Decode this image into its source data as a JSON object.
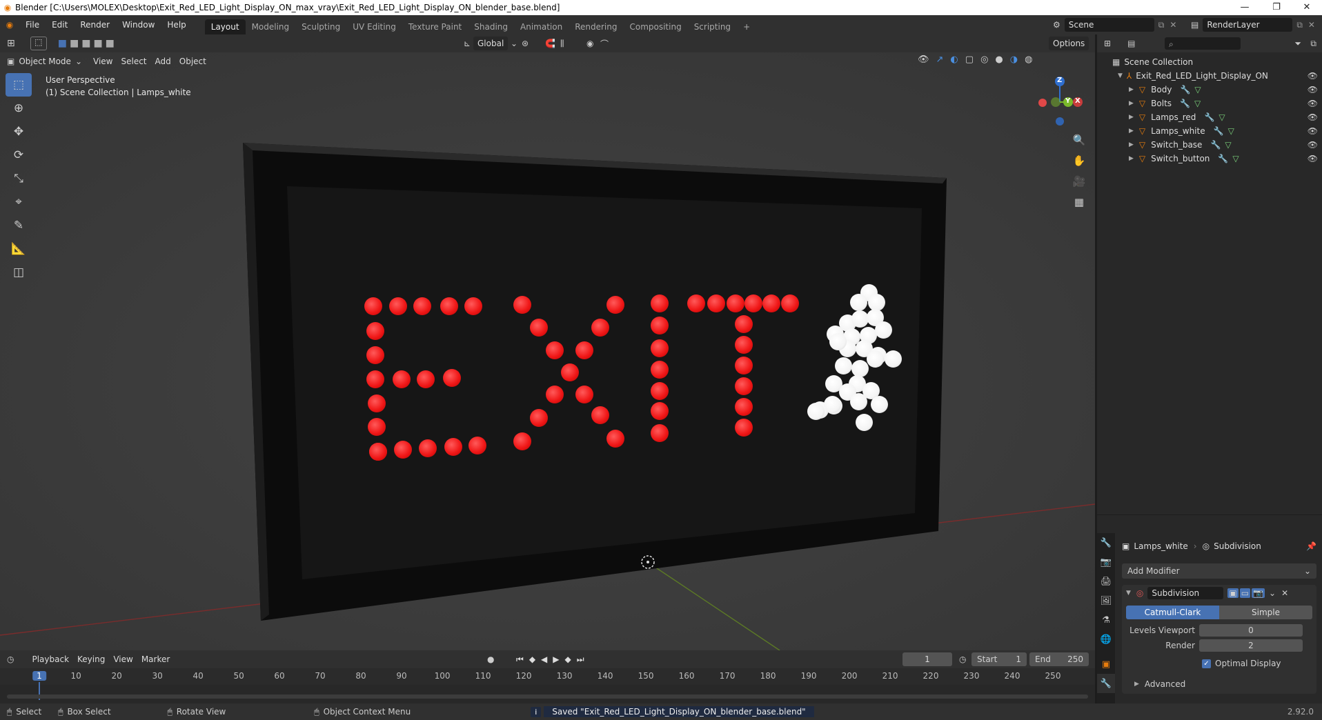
{
  "titlebar": {
    "title": "Blender [C:\\Users\\MOLEX\\Desktop\\Exit_Red_LED_Light_Display_ON_max_vray\\Exit_Red_LED_Light_Display_ON_blender_base.blend]",
    "minimize": "—",
    "maximize": "❐",
    "close": "✕"
  },
  "menu": {
    "items": [
      "File",
      "Edit",
      "Render",
      "Window",
      "Help"
    ]
  },
  "workspaces": {
    "tabs": [
      "Layout",
      "Modeling",
      "Sculpting",
      "UV Editing",
      "Texture Paint",
      "Shading",
      "Animation",
      "Rendering",
      "Compositing",
      "Scripting"
    ],
    "active": "Layout",
    "add": "+"
  },
  "scene": {
    "name": "Scene",
    "render_layer": "RenderLayer"
  },
  "viewport_header": {
    "mode": "Object Mode",
    "menus": [
      "View",
      "Select",
      "Add",
      "Object"
    ],
    "transform_orientation": "Global",
    "options": "Options"
  },
  "viewport": {
    "perspective_label": "User Perspective",
    "collection_label": "(1) Scene Collection | Lamps_white",
    "gizmo_axes": {
      "x": "X",
      "y": "Y",
      "z": "Z"
    }
  },
  "outliner": {
    "root": "Scene Collection",
    "collection": "Exit_Red_LED_Light_Display_ON",
    "objects": [
      "Body",
      "Bolts",
      "Lamps_red",
      "Lamps_white",
      "Switch_base",
      "Switch_button"
    ]
  },
  "properties": {
    "object_name": "Lamps_white",
    "modifier_context": "Subdivision",
    "add_modifier": "Add Modifier",
    "modifier_name": "Subdivision",
    "subdiv_types": [
      "Catmull-Clark",
      "Simple"
    ],
    "active_subdiv_type": "Catmull-Clark",
    "levels_viewport_label": "Levels Viewport",
    "levels_viewport_value": "0",
    "render_label": "Render",
    "render_value": "2",
    "optimal_display_label": "Optimal Display",
    "optimal_display_checked": true,
    "advanced_label": "Advanced"
  },
  "timeline": {
    "menus": [
      "Playback",
      "Keying",
      "View",
      "Marker"
    ],
    "current_frame": "1",
    "start_label": "Start",
    "start_value": "1",
    "end_label": "End",
    "end_value": "250",
    "ruler_ticks": [
      "1",
      "10",
      "20",
      "30",
      "40",
      "50",
      "60",
      "70",
      "80",
      "90",
      "100",
      "110",
      "120",
      "130",
      "140",
      "150",
      "160",
      "170",
      "180",
      "190",
      "200",
      "210",
      "220",
      "230",
      "240",
      "250"
    ]
  },
  "statusbar": {
    "select": "Select",
    "box_select": "Box Select",
    "rotate_view": "Rotate View",
    "context_menu": "Object Context Menu",
    "message": "Saved \"Exit_Red_LED_Light_Display_ON_blender_base.blend\"",
    "version": "2.92.0"
  },
  "colors": {
    "accent": "#4772b3",
    "led_red": "#f01818",
    "led_white": "#ffffff",
    "object_orange": "#e87d0d"
  }
}
